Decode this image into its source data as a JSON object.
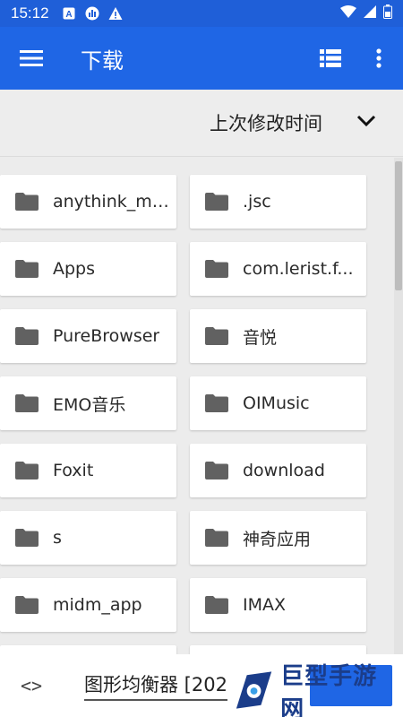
{
  "status_bar": {
    "time": "15:12",
    "icons": [
      "a-icon",
      "bar-chart-icon",
      "warning-icon",
      "wifi-icon",
      "signal-icon",
      "battery-icon"
    ]
  },
  "app_bar": {
    "title": "下载",
    "menu_icon": "menu-icon",
    "view_icon": "list-view-icon",
    "more_icon": "more-vert-icon",
    "color": "#1f66e5"
  },
  "sort": {
    "label": "上次修改时间",
    "icon": "chevron-down-icon"
  },
  "folders": [
    {
      "name": "anythink_my..."
    },
    {
      "name": ".jsc"
    },
    {
      "name": "Apps"
    },
    {
      "name": "com.lerist.f..."
    },
    {
      "name": "PureBrowser"
    },
    {
      "name": "音悦"
    },
    {
      "name": "EMO音乐"
    },
    {
      "name": "OIMusic"
    },
    {
      "name": "Foxit"
    },
    {
      "name": "download"
    },
    {
      "name": "s"
    },
    {
      "name": "神奇应用"
    },
    {
      "name": "midm_app"
    },
    {
      "name": "IMAX"
    },
    {
      "name": ""
    },
    {
      "name": ""
    }
  ],
  "bottom": {
    "code_label": "<>",
    "filename": "图形均衡器 [202"
  },
  "watermark": {
    "text": "巨型手游网"
  }
}
